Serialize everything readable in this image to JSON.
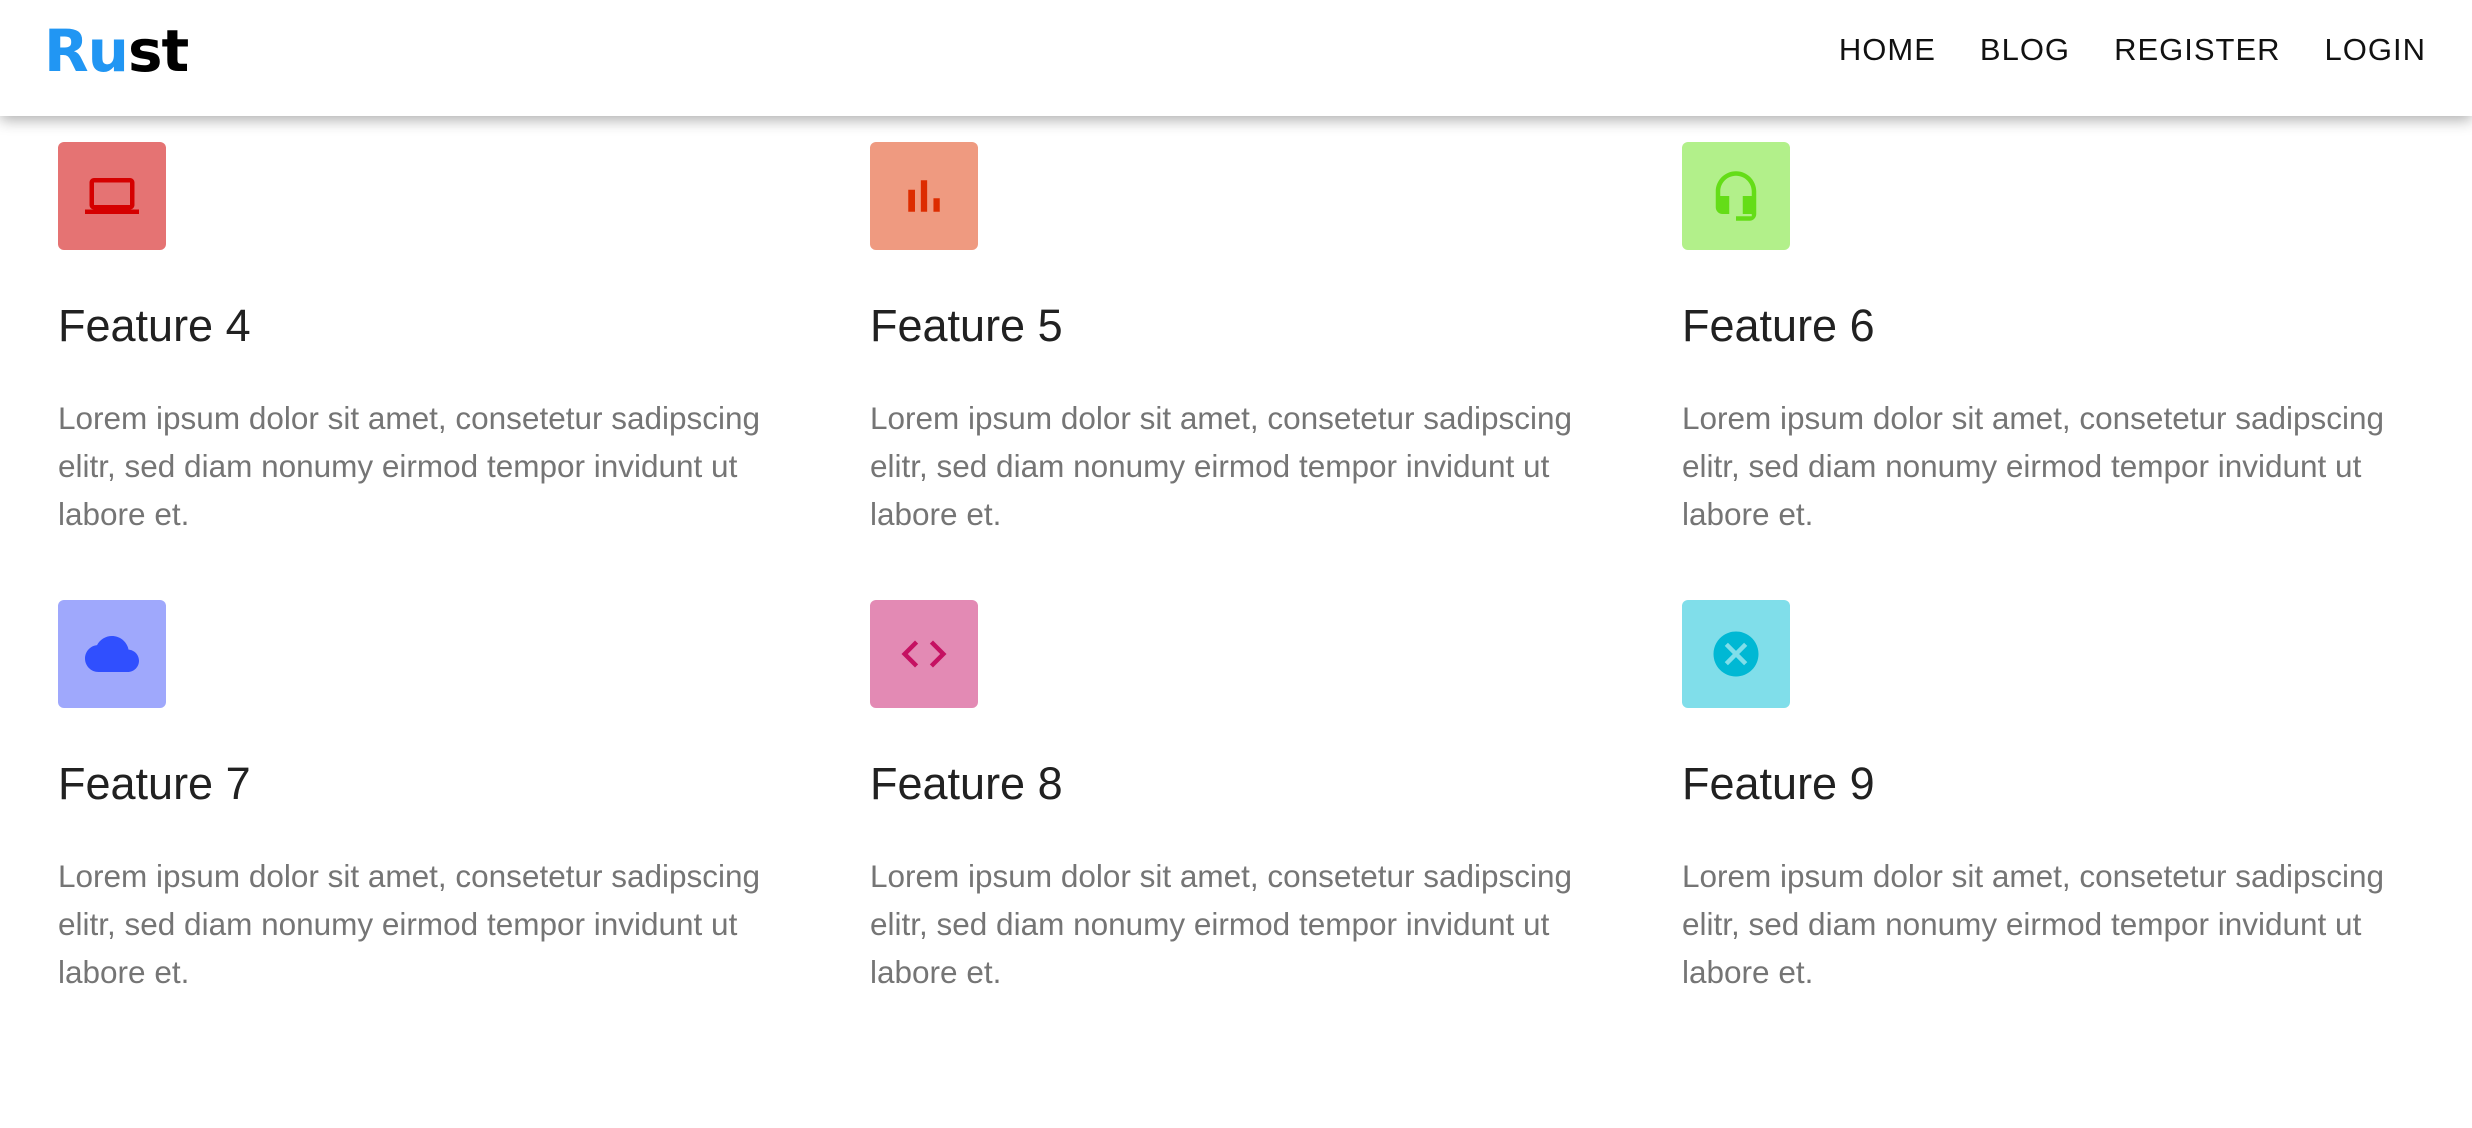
{
  "brand": {
    "logo_part1": "Ru",
    "logo_part2": "st",
    "logo_color_part1": "#2196f3",
    "logo_color_part2": "#000000"
  },
  "nav": {
    "items": [
      {
        "label": "HOME"
      },
      {
        "label": "BLOG"
      },
      {
        "label": "REGISTER"
      },
      {
        "label": "LOGIN"
      }
    ]
  },
  "features": [
    {
      "title": "Feature 4",
      "text": "Lorem ipsum dolor sit amet, consetetur sadipscing elitr, sed diam nonumy eirmod tempor invidunt ut labore et.",
      "icon": "laptop-icon",
      "bg": "#e57373",
      "fg": "#d50000"
    },
    {
      "title": "Feature 5",
      "text": "Lorem ipsum dolor sit amet, consetetur sadipscing elitr, sed diam nonumy eirmod tempor invidunt ut labore et.",
      "icon": "bar-chart-icon",
      "bg": "#ef9a80",
      "fg": "#dd2c00"
    },
    {
      "title": "Feature 6",
      "text": "Lorem ipsum dolor sit amet, consetetur sadipscing elitr, sed diam nonumy eirmod tempor invidunt ut labore et.",
      "icon": "headset-icon",
      "bg": "#b2f08a",
      "fg": "#64dd17"
    },
    {
      "title": "Feature 7",
      "text": "Lorem ipsum dolor sit amet, consetetur sadipscing elitr, sed diam nonumy eirmod tempor invidunt ut labore et.",
      "icon": "cloud-icon",
      "bg": "#9fa8fc",
      "fg": "#304ffe"
    },
    {
      "title": "Feature 8",
      "text": "Lorem ipsum dolor sit amet, consetetur sadipscing elitr, sed diam nonumy eirmod tempor invidunt ut labore et.",
      "icon": "code-icon",
      "bg": "#e38ab4",
      "fg": "#c51162"
    },
    {
      "title": "Feature 9",
      "text": "Lorem ipsum dolor sit amet, consetetur sadipscing elitr, sed diam nonumy eirmod tempor invidunt ut labore et.",
      "icon": "cancel-icon",
      "bg": "#80deea",
      "fg": "#00b8d4"
    }
  ]
}
